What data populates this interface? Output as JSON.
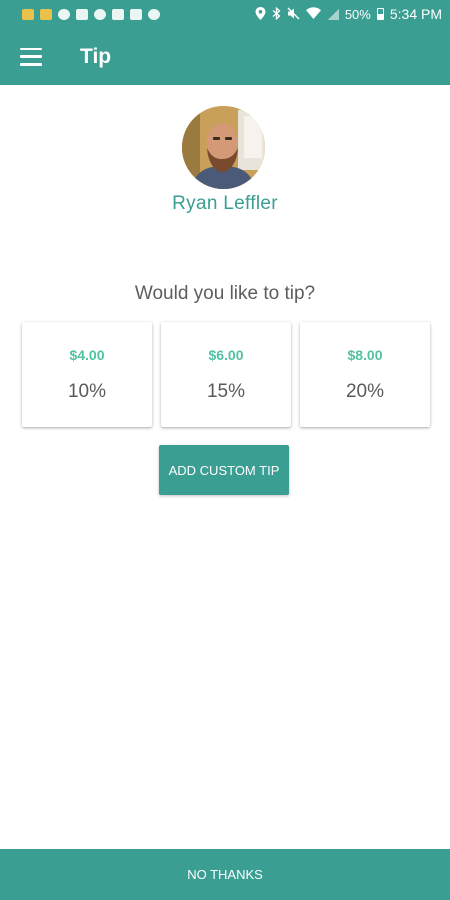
{
  "status_bar": {
    "notification_icons": [
      "gmail-icon",
      "gmail-icon",
      "sync-icon",
      "mail-icon",
      "sync-icon",
      "mail-icon",
      "image-icon",
      "add-icon"
    ],
    "system_icons": [
      "location-icon",
      "bluetooth-icon",
      "mute-icon",
      "wifi-icon",
      "signal-icon"
    ],
    "battery": "50%",
    "time": "5:34 PM"
  },
  "app_bar": {
    "title": "Tip",
    "menu_icon": "menu-icon"
  },
  "profile": {
    "name": "Ryan Leffler"
  },
  "prompt": "Would you like to tip?",
  "tip_options": [
    {
      "amount": "$4.00",
      "percent": "10%"
    },
    {
      "amount": "$6.00",
      "percent": "15%"
    },
    {
      "amount": "$8.00",
      "percent": "20%"
    }
  ],
  "buttons": {
    "custom_tip": "ADD CUSTOM TIP",
    "no_thanks": "NO THANKS"
  },
  "colors": {
    "primary": "#3a9e92",
    "accent_amount": "#52c1a4",
    "text": "#5a5a5a",
    "background": "#ffffff"
  }
}
